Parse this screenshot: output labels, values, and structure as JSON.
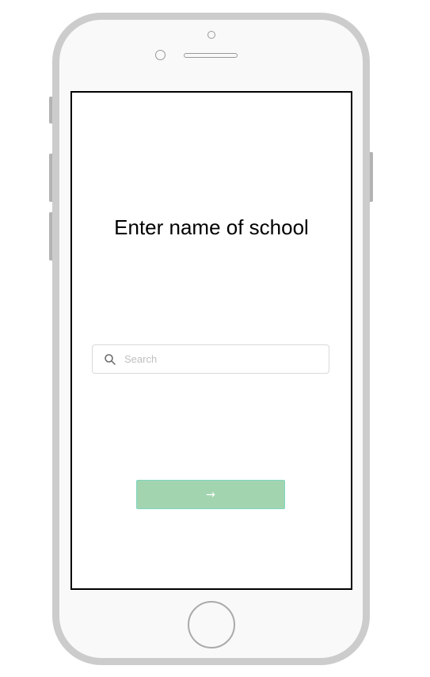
{
  "screen": {
    "title": "Enter name of school"
  },
  "search": {
    "placeholder": "Search",
    "value": "",
    "icon": "search-icon"
  },
  "next_button": {
    "icon": "arrow-right-icon",
    "glyph": "→",
    "disabled": true
  },
  "colors": {
    "button_bg": "#a3d4b0",
    "button_border": "#7fd6c2",
    "phone_frame": "#cccccc",
    "screen_border": "#000000"
  }
}
